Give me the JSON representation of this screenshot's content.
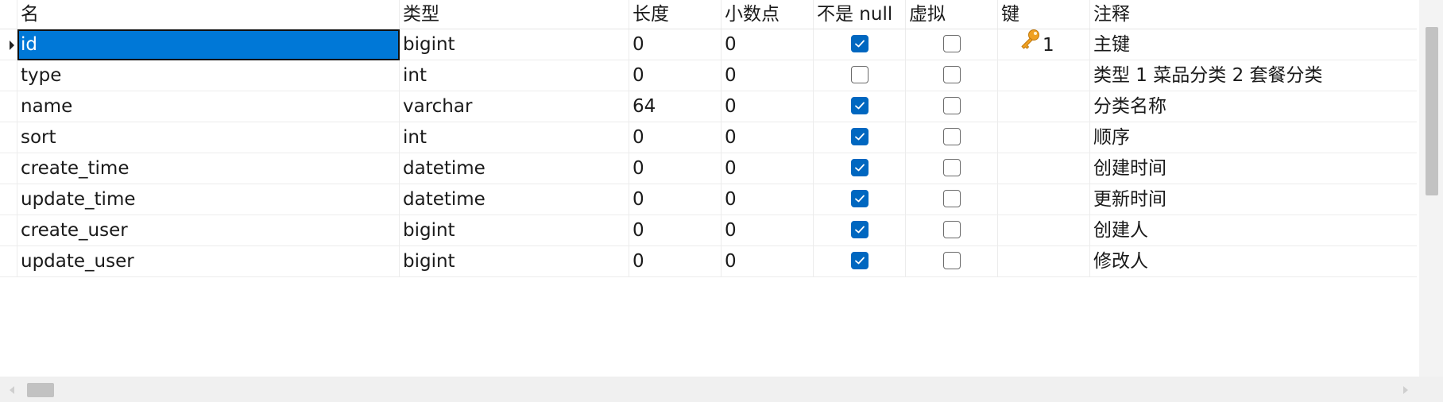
{
  "headers": [
    "名",
    "类型",
    "长度",
    "小数点",
    "不是 null",
    "虚拟",
    "键",
    "注释"
  ],
  "rows": [
    {
      "name": "id",
      "type": "bigint",
      "length": "0",
      "decimals": "0",
      "not_null": true,
      "virtual": false,
      "key": "1",
      "comment": "主键",
      "selected": true
    },
    {
      "name": "type",
      "type": "int",
      "length": "0",
      "decimals": "0",
      "not_null": false,
      "virtual": false,
      "key": "",
      "comment": "类型   1 菜品分类 2 套餐分类"
    },
    {
      "name": "name",
      "type": "varchar",
      "length": "64",
      "decimals": "0",
      "not_null": true,
      "virtual": false,
      "key": "",
      "comment": "分类名称"
    },
    {
      "name": "sort",
      "type": "int",
      "length": "0",
      "decimals": "0",
      "not_null": true,
      "virtual": false,
      "key": "",
      "comment": "顺序"
    },
    {
      "name": "create_time",
      "type": "datetime",
      "length": "0",
      "decimals": "0",
      "not_null": true,
      "virtual": false,
      "key": "",
      "comment": "创建时间"
    },
    {
      "name": "update_time",
      "type": "datetime",
      "length": "0",
      "decimals": "0",
      "not_null": true,
      "virtual": false,
      "key": "",
      "comment": "更新时间"
    },
    {
      "name": "create_user",
      "type": "bigint",
      "length": "0",
      "decimals": "0",
      "not_null": true,
      "virtual": false,
      "key": "",
      "comment": "创建人"
    },
    {
      "name": "update_user",
      "type": "bigint",
      "length": "0",
      "decimals": "0",
      "not_null": true,
      "virtual": false,
      "key": "",
      "comment": "修改人"
    }
  ],
  "icons": {
    "key": "key-icon",
    "checkbox_on": "checkbox-checked-icon",
    "checkbox_off": "checkbox-unchecked-icon",
    "row_marker": "current-row-marker-icon"
  },
  "colors": {
    "selection": "#0078d7",
    "checkbox": "#0067c0",
    "key": "#f0a020"
  }
}
